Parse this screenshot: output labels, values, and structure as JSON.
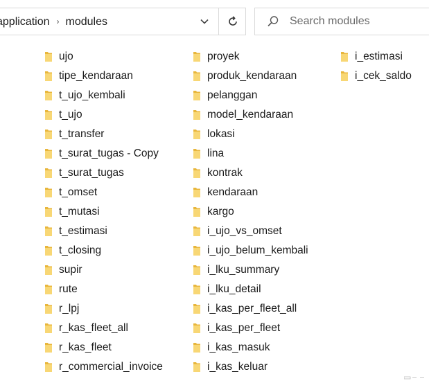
{
  "breadcrumb": {
    "segments": [
      "application",
      "modules"
    ],
    "separator": "›"
  },
  "search": {
    "placeholder": "Search modules",
    "value": ""
  },
  "icons": {
    "dropdown": "chevron-down-icon",
    "refresh": "refresh-icon",
    "search": "search-icon",
    "folder": "folder-icon"
  },
  "colors": {
    "folder_body": "#E8B63C",
    "folder_front": "#F8D775",
    "border": "#D9D9D9"
  },
  "files": {
    "column1": [
      "ujo",
      "tipe_kendaraan",
      "t_ujo_kembali",
      "t_ujo",
      "t_transfer",
      "t_surat_tugas - Copy",
      "t_surat_tugas",
      "t_omset",
      "t_mutasi",
      "t_estimasi",
      "t_closing",
      "supir",
      "rute",
      "r_lpj",
      "r_kas_fleet_all",
      "r_kas_fleet",
      "r_commercial_invoice"
    ],
    "column2": [
      "proyek",
      "produk_kendaraan",
      "pelanggan",
      "model_kendaraan",
      "lokasi",
      "lina",
      "kontrak",
      "kendaraan",
      "kargo",
      "i_ujo_vs_omset",
      "i_ujo_belum_kembali",
      "i_lku_summary",
      "i_lku_detail",
      "i_kas_per_fleet_all",
      "i_kas_per_fleet",
      "i_kas_masuk",
      "i_kas_keluar"
    ],
    "column3": [
      "i_estimasi",
      "i_cek_saldo"
    ]
  }
}
